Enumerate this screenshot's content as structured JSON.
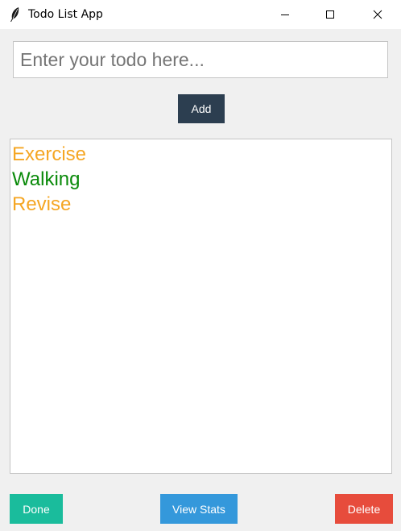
{
  "window": {
    "title": "Todo List App",
    "icon": "feather-icon"
  },
  "input": {
    "placeholder": "Enter your todo here...",
    "value": ""
  },
  "buttons": {
    "add": "Add",
    "done": "Done",
    "stats": "View Stats",
    "delete": "Delete"
  },
  "todos": [
    {
      "text": "Exercise",
      "color": "#f5a623"
    },
    {
      "text": "Walking",
      "color": "#0a8a0a"
    },
    {
      "text": "Revise",
      "color": "#f5a623"
    }
  ],
  "colors": {
    "add_button": "#2c3e50",
    "done_button": "#1abc9c",
    "stats_button": "#3498db",
    "delete_button": "#e74c3c"
  }
}
